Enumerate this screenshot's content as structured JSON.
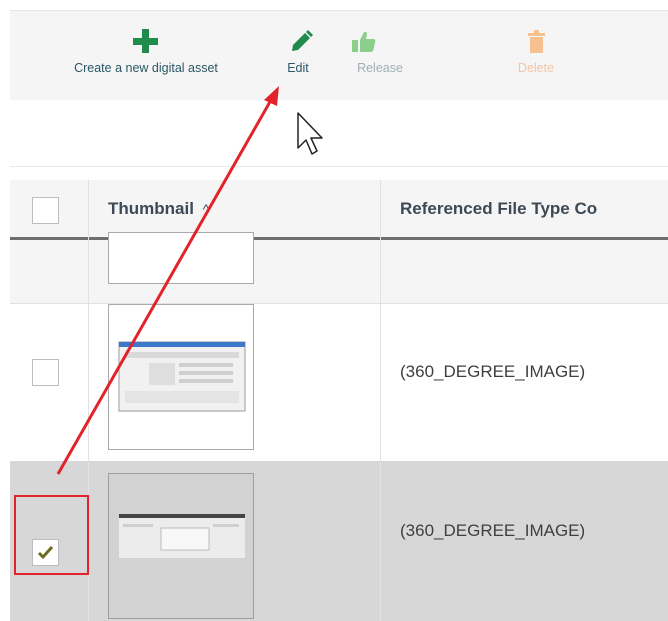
{
  "toolbar": {
    "create_label": "Create a new digital asset",
    "edit_label": "Edit",
    "release_label": "Release",
    "delete_label": "Delete"
  },
  "table": {
    "columns": [
      "Thumbnail",
      "Referenced File Type Co"
    ],
    "sort_indicator": "^",
    "rows": [
      {
        "referenced_file_type": "",
        "checked": false,
        "selected": false
      },
      {
        "referenced_file_type": "(360_DEGREE_IMAGE)",
        "checked": false,
        "selected": false
      },
      {
        "referenced_file_type": "(360_DEGREE_IMAGE)",
        "checked": true,
        "selected": true
      }
    ]
  },
  "colors": {
    "create_icon": "#1f8c4e",
    "edit_icon": "#1f8c4e",
    "release_icon": "#8ccf8a",
    "delete_icon": "#f6c08f",
    "annotation": "#e2232c",
    "selected_row": "#d7d7d7",
    "checkmark": "#6b6b1f"
  },
  "icons": {
    "create": "plus-icon",
    "edit": "pencil-icon",
    "release": "thumbs-up-icon",
    "delete": "trash-icon",
    "cursor": "mouse-pointer-icon"
  }
}
